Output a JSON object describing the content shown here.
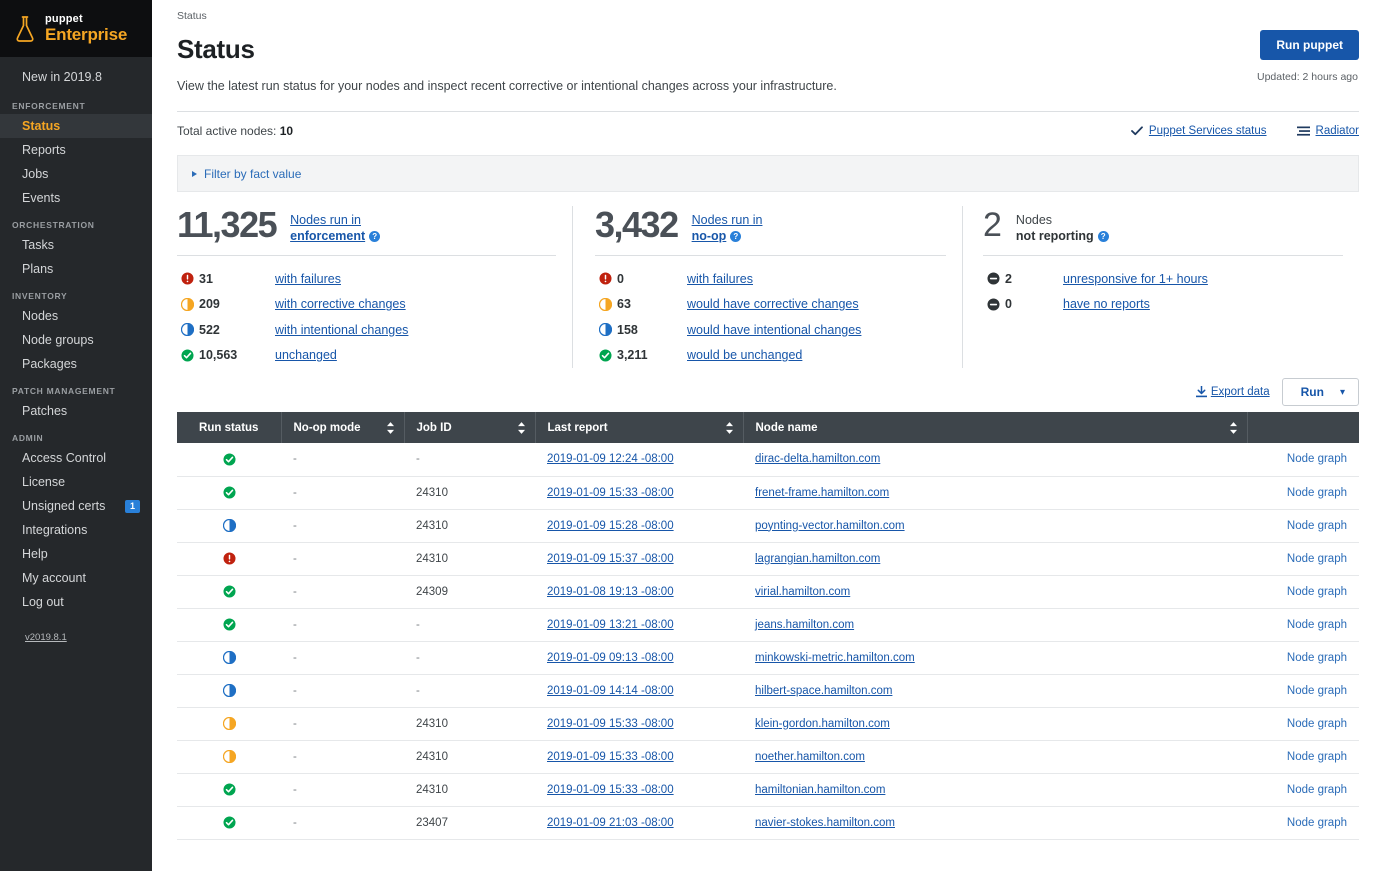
{
  "brand": {
    "name_top": "puppet",
    "name_bottom": "Enterprise",
    "logo_icon": "flask-icon",
    "accent": "#f5a623"
  },
  "sidebar": {
    "top_item": {
      "label": "New in 2019.8"
    },
    "version": "v2019.8.1",
    "groups": [
      {
        "title": "ENFORCEMENT",
        "items": [
          {
            "label": "Status",
            "active": true
          },
          {
            "label": "Reports",
            "active": false
          },
          {
            "label": "Jobs",
            "active": false
          },
          {
            "label": "Events",
            "active": false
          }
        ]
      },
      {
        "title": "ORCHESTRATION",
        "items": [
          {
            "label": "Tasks",
            "active": false
          },
          {
            "label": "Plans",
            "active": false
          }
        ]
      },
      {
        "title": "INVENTORY",
        "items": [
          {
            "label": "Nodes",
            "active": false
          },
          {
            "label": "Node groups",
            "active": false
          },
          {
            "label": "Packages",
            "active": false
          }
        ]
      },
      {
        "title": "PATCH MANAGEMENT",
        "items": [
          {
            "label": "Patches",
            "active": false
          }
        ]
      },
      {
        "title": "ADMIN",
        "items": [
          {
            "label": "Access Control",
            "active": false
          },
          {
            "label": "License",
            "active": false
          },
          {
            "label": "Unsigned certs",
            "active": false,
            "badge": "1"
          },
          {
            "label": "Integrations",
            "active": false
          },
          {
            "label": "Help",
            "active": false
          },
          {
            "label": "My account",
            "active": false
          },
          {
            "label": "Log out",
            "active": false
          }
        ]
      }
    ]
  },
  "header": {
    "breadcrumb": "Status",
    "title": "Status",
    "description": "View the latest run status for your nodes and inspect recent corrective or intentional changes across your infrastructure.",
    "run_puppet_label": "Run puppet",
    "updated": "Updated: 2 hours ago"
  },
  "subbar": {
    "total_label": "Total active nodes:",
    "total_value": "10",
    "services_status_label": "Puppet Services status",
    "services_status_icon": "check-icon",
    "radiator_label": "Radiator",
    "radiator_icon": "radiator-icon"
  },
  "filter": {
    "label": "Filter by fact value",
    "expand_icon": "triangle-right-icon"
  },
  "cards": [
    {
      "value": "11,325",
      "label_line1": "Nodes run in",
      "label_line2": "enforcement",
      "help_icon": "help-icon",
      "rows": [
        {
          "icon": "error-icon",
          "count": "31",
          "label": "with failures"
        },
        {
          "icon": "corrective-icon",
          "count": "209",
          "label": "with corrective changes"
        },
        {
          "icon": "intentional-icon",
          "count": "522",
          "label": "with intentional changes"
        },
        {
          "icon": "success-icon",
          "count": "10,563",
          "label": "unchanged"
        }
      ]
    },
    {
      "value": "3,432",
      "label_line1": "Nodes run in",
      "label_line2": "no-op",
      "help_icon": "help-icon",
      "rows": [
        {
          "icon": "error-icon",
          "count": "0",
          "label": "with failures"
        },
        {
          "icon": "corrective-icon",
          "count": "63",
          "label": "would have corrective changes"
        },
        {
          "icon": "intentional-icon",
          "count": "158",
          "label": "would have intentional changes"
        },
        {
          "icon": "success-icon",
          "count": "3,211",
          "label": "would be unchanged"
        }
      ]
    },
    {
      "value": "2",
      "label_line1": "Nodes",
      "label_line2": "not reporting",
      "help_icon": "help-icon",
      "rows": [
        {
          "icon": "minus-icon",
          "count": "2",
          "label": "unresponsive for 1+ hours"
        },
        {
          "icon": "minus-icon",
          "count": "0",
          "label": "have no reports"
        }
      ]
    }
  ],
  "table_controls": {
    "export_label": "Export data",
    "export_icon": "download-icon",
    "run_label": "Run",
    "caret_icon": "chevron-down-icon"
  },
  "table": {
    "columns": [
      {
        "label": "Run status",
        "sortable": false
      },
      {
        "label": "No-op mode",
        "sortable": true
      },
      {
        "label": "Job ID",
        "sortable": true
      },
      {
        "label": "Last report",
        "sortable": true
      },
      {
        "label": "Node name",
        "sortable": true
      },
      {
        "label": "",
        "sortable": false
      }
    ],
    "graph_link_label": "Node graph",
    "rows": [
      {
        "status": "success-icon",
        "noop": "-",
        "job": "-",
        "report": "2019-01-09 12:24 -08:00",
        "node": "dirac-delta.hamilton.com"
      },
      {
        "status": "success-icon",
        "noop": "-",
        "job": "24310",
        "report": "2019-01-09 15:33 -08:00",
        "node": "frenet-frame.hamilton.com"
      },
      {
        "status": "intentional-icon",
        "noop": "-",
        "job": "24310",
        "report": "2019-01-09 15:28 -08:00",
        "node": "poynting-vector.hamilton.com"
      },
      {
        "status": "error-icon",
        "noop": "-",
        "job": "24310",
        "report": "2019-01-09 15:37 -08:00",
        "node": "lagrangian.hamilton.com"
      },
      {
        "status": "success-icon",
        "noop": "-",
        "job": "24309",
        "report": "2019-01-08 19:13 -08:00",
        "node": "virial.hamilton.com"
      },
      {
        "status": "success-icon",
        "noop": "-",
        "job": "-",
        "report": "2019-01-09 13:21 -08:00",
        "node": "jeans.hamilton.com"
      },
      {
        "status": "intentional-icon",
        "noop": "-",
        "job": "-",
        "report": "2019-01-09 09:13 -08:00",
        "node": "minkowski-metric.hamilton.com"
      },
      {
        "status": "intentional-icon",
        "noop": "-",
        "job": "-",
        "report": "2019-01-09 14:14 -08:00",
        "node": "hilbert-space.hamilton.com"
      },
      {
        "status": "corrective-icon",
        "noop": "-",
        "job": "24310",
        "report": "2019-01-09 15:33 -08:00",
        "node": "klein-gordon.hamilton.com"
      },
      {
        "status": "corrective-icon",
        "noop": "-",
        "job": "24310",
        "report": "2019-01-09 15:33 -08:00",
        "node": "noether.hamilton.com"
      },
      {
        "status": "success-icon",
        "noop": "-",
        "job": "24310",
        "report": "2019-01-09 15:33 -08:00",
        "node": "hamiltonian.hamilton.com"
      },
      {
        "status": "success-icon",
        "noop": "-",
        "job": "23407",
        "report": "2019-01-09 21:03 -08:00",
        "node": "navier-stokes.hamilton.com"
      }
    ]
  },
  "colors": {
    "success": "#00a550",
    "error": "#c0220f",
    "corrective": "#f5a623",
    "intentional": "#1f6fc4",
    "neutral": "#3f4549",
    "link": "#1756a9",
    "primary_button": "#1756a9"
  }
}
